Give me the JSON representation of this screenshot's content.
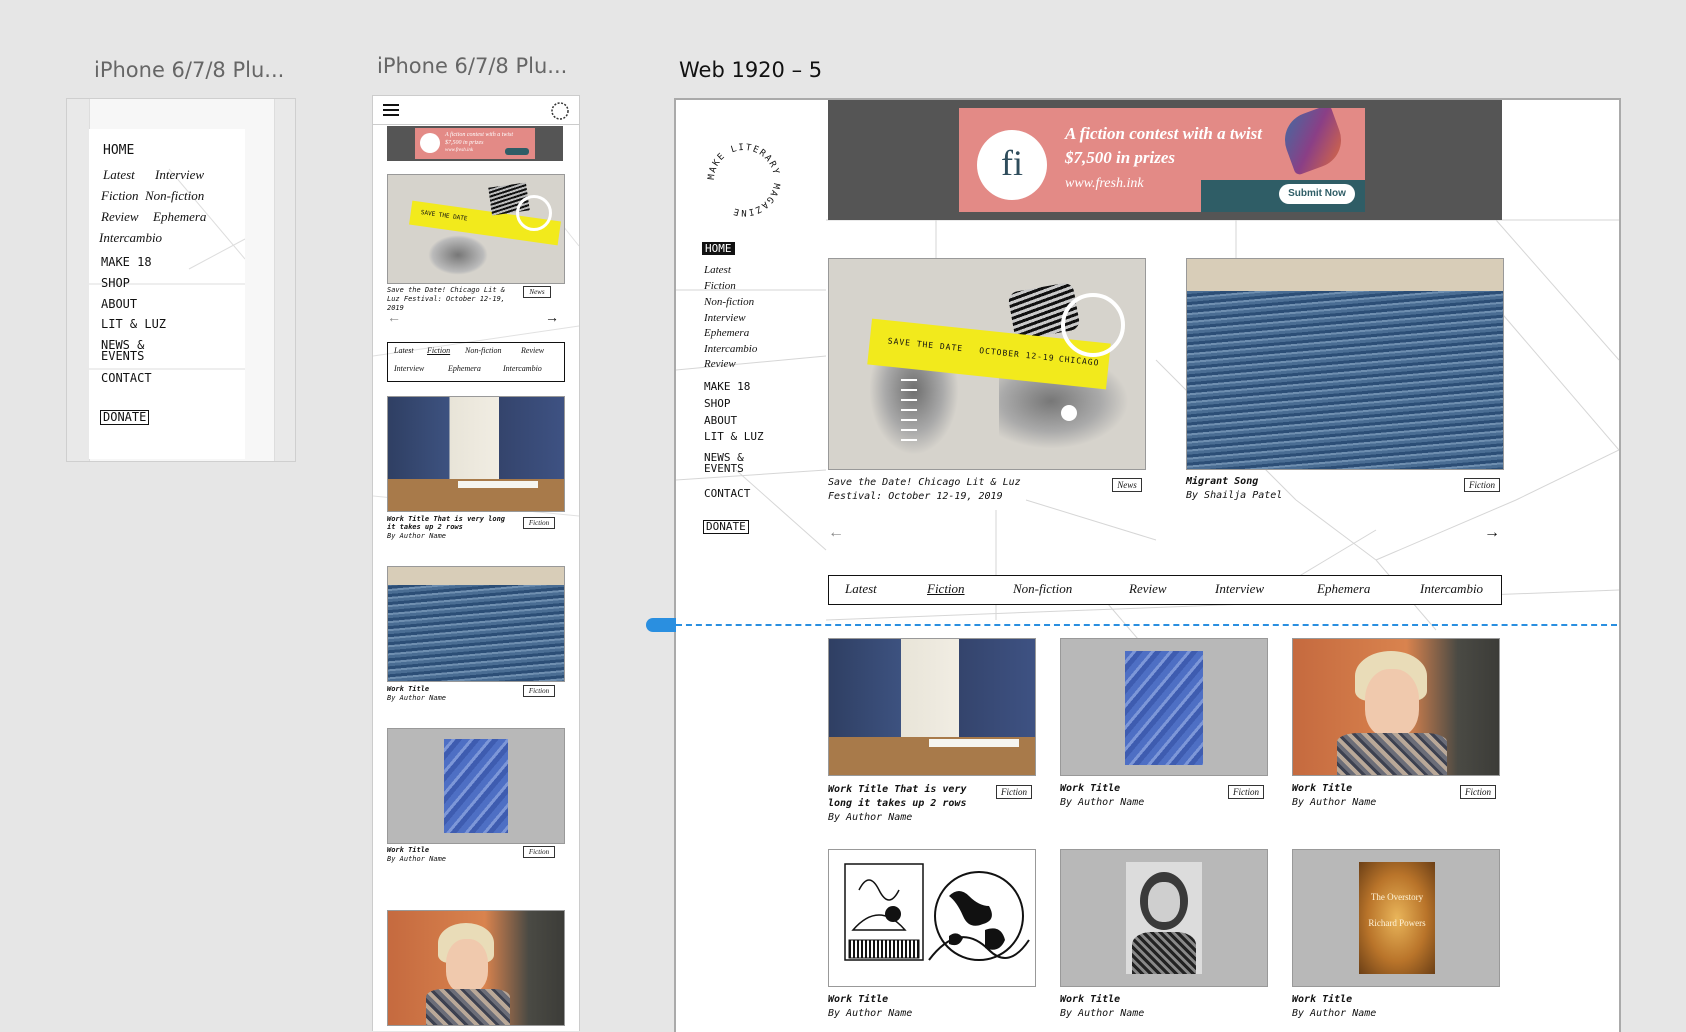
{
  "artboards": {
    "phone_menu_title": "iPhone 6/7/8 Plu...",
    "phone_home_title": "iPhone 6/7/8 Plu...",
    "web_title": "Web 1920 – 5"
  },
  "colors": {
    "canvas": "#e6e6e6",
    "guide": "#2a8fe0",
    "ad_bg": "#555555",
    "ad_banner": "#e38a86",
    "event_yellow": "#f2ea1c"
  },
  "phone_menu": {
    "home": "HOME",
    "latest": "Latest",
    "interview": "Interview",
    "fiction": "Fiction",
    "nonfiction": "Non-fiction",
    "review": "Review",
    "ephemera": "Ephemera",
    "intercambio": "Intercambio",
    "make18": "MAKE 18",
    "shop": "SHOP",
    "about": "ABOUT",
    "litluz": "LIT & LUZ",
    "news": "NEWS &",
    "events": "EVENTS",
    "contact": "CONTACT",
    "donate": "DONATE"
  },
  "ad": {
    "logo": "fi",
    "headline1": "A fiction contest with a twist",
    "headline2": "$7,500 in prizes",
    "url": "www.fresh.ink",
    "button": "Submit Now"
  },
  "event": {
    "save": "SAVE THE DATE",
    "date": "OCTOBER 12-19",
    "city": "CHICAGO"
  },
  "phone_home": {
    "hero_caption": "Save the Date! Chicago Lit & Luz Festival: October 12-19, 2019",
    "hero_tag": "News",
    "prev_arrow": "←",
    "next_arrow": "→",
    "cat_row1": [
      "Latest",
      "Fiction",
      "Non-fiction",
      "Review"
    ],
    "cat_row2": [
      "Interview",
      "Ephemera",
      "Intercambio"
    ],
    "cards": [
      {
        "title": "Work Title That is very long it takes up 2 rows",
        "author": "By Author Name",
        "tag": "Fiction"
      },
      {
        "title": "Work Title",
        "author": "By Author Name",
        "tag": "Fiction"
      },
      {
        "title": "Work Title",
        "author": "By Author Name",
        "tag": "Fiction"
      }
    ]
  },
  "web": {
    "logo_text": "MAKE LITERARY MAGAZINE",
    "nav": {
      "home": "HOME",
      "italic": [
        "Latest",
        "Fiction",
        "Non-fiction",
        "Interview",
        "Ephemera",
        "Intercambio",
        "Review"
      ],
      "make18": "MAKE 18",
      "shop": "SHOP",
      "about": "ABOUT",
      "litluz": "LIT & LUZ",
      "news": "NEWS &",
      "events": "EVENTS",
      "contact": "CONTACT",
      "donate": "DONATE"
    },
    "feature1": {
      "caption_line1": "Save the Date! Chicago Lit & Luz",
      "caption_line2": "Festival: October 12-19, 2019",
      "tag": "News"
    },
    "feature2": {
      "title": "Migrant Song",
      "author": "By Shailja Patel",
      "tag": "Fiction"
    },
    "prev_arrow": "←",
    "next_arrow": "→",
    "categories": [
      "Latest",
      "Fiction",
      "Non-fiction",
      "Review",
      "Interview",
      "Ephemera",
      "Intercambio"
    ],
    "grid": [
      {
        "title_line1": "Work Title That is very",
        "title_line2": "long it takes up 2 rows",
        "author": "By Author Name",
        "tag": "Fiction"
      },
      {
        "title_line1": "Work Title",
        "author": "By Author Name",
        "tag": "Fiction"
      },
      {
        "title_line1": "Work Title",
        "author": "By Author Name",
        "tag": "Fiction"
      },
      {
        "title_line1": "Work Title",
        "author": "By Author Name"
      },
      {
        "title_line1": "Work Title",
        "author": "By Author Name"
      },
      {
        "title_line1": "Work Title",
        "author": "By Author Name"
      }
    ],
    "book_title": "The Overstory",
    "book_author": "Richard Powers"
  }
}
